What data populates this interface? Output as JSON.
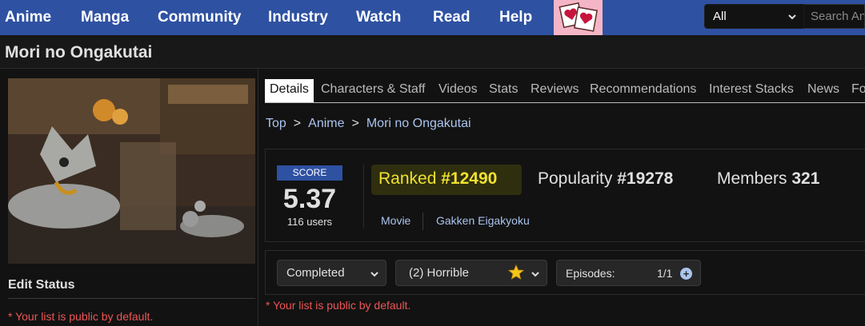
{
  "nav": {
    "items": [
      "Anime",
      "Manga",
      "Community",
      "Industry",
      "Watch",
      "Read",
      "Help"
    ],
    "search": {
      "category": "All",
      "placeholder": "Search An"
    }
  },
  "page": {
    "title": "Mori no Ongakutai"
  },
  "left": {
    "edit_status_heading": "Edit Status",
    "note": "* Your list is public by default."
  },
  "tabs": [
    "Details",
    "Characters & Staff",
    "Videos",
    "Stats",
    "Reviews",
    "Recommendations",
    "Interest Stacks",
    "News",
    "Fo"
  ],
  "breadcrumb": [
    "Top",
    "Anime",
    "Mori no Ongakutai"
  ],
  "stats": {
    "score_label": "SCORE",
    "score": "5.37",
    "score_users": "116 users",
    "ranked_label": "Ranked",
    "ranked_value": "#12490",
    "popularity_label": "Popularity",
    "popularity_value": "#19278",
    "members_label": "Members",
    "members_value": "321",
    "type": "Movie",
    "studio": "Gakken Eigakyoku"
  },
  "list": {
    "status": "Completed",
    "rating": "(2) Horrible",
    "episodes_label": "Episodes:",
    "episodes_value": "1/1",
    "note": "* Your list is public by default."
  },
  "colors": {
    "nav_bg": "#2e51a2",
    "link": "#abc4ed",
    "ranked_highlight": "#f0e130",
    "note_red": "#ee5555"
  }
}
